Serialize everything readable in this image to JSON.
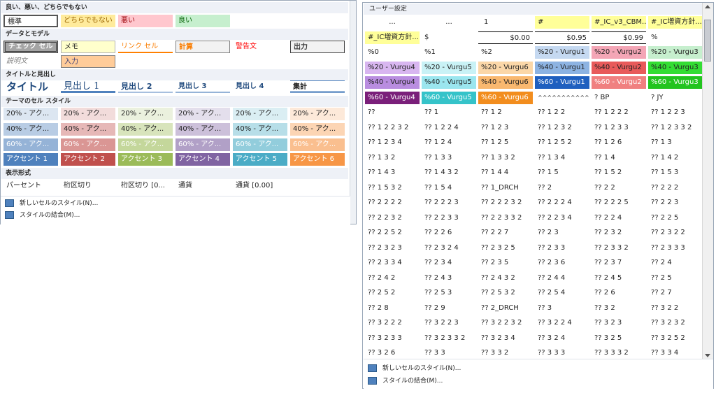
{
  "left": {
    "sections": {
      "good_bad": "良い、悪い、どちらでもない",
      "data_model": "データとモデル",
      "title_heading": "タイトルと見出し",
      "theme": "テーマのセル スタイル",
      "number_format": "表示形式"
    },
    "good_bad_cells": [
      "標準",
      "どちらでもない",
      "悪い",
      "良い"
    ],
    "data_model_row1": [
      "チェック セル",
      "メモ",
      "リンク セル",
      "計算",
      "警告文",
      "出力"
    ],
    "data_model_row2": [
      "説明文",
      "入力"
    ],
    "title_cells": [
      "タイトル",
      "見出し 1",
      "見出し 2",
      "見出し 3",
      "見出し 4",
      "集計"
    ],
    "theme_rows": [
      [
        "20% - アク...",
        "20% - アク...",
        "20% - アク...",
        "20% - アク...",
        "20% - アク...",
        "20% - アク..."
      ],
      [
        "40% - アク...",
        "40% - アク...",
        "40% - アク...",
        "40% - アク...",
        "40% - アク...",
        "40% - アク..."
      ],
      [
        "60% - アク...",
        "60% - アク...",
        "60% - アク...",
        "60% - アク...",
        "60% - アク...",
        "60% - アク..."
      ],
      [
        "アクセント 1",
        "アクセント 2",
        "アクセント 3",
        "アクセント 4",
        "アクセント 5",
        "アクセント 6"
      ]
    ],
    "number_cells": [
      "パーセント",
      "桁区切り",
      "桁区切り [0...",
      "通貨",
      "通貨 [0.00]"
    ],
    "links": [
      "新しいセルのスタイル(N)...",
      "スタイルの結合(M)..."
    ]
  },
  "right": {
    "title": "ユーザー設定",
    "rows": [
      [
        "...",
        "...",
        "1",
        "#",
        "#_IC_v3_CBM...",
        "#_IC増資方針..."
      ],
      [
        "#_IC増資方針...",
        "$",
        "$0.00",
        "$0.95",
        "$0.99",
        "%"
      ],
      [
        "%0",
        "%1",
        "%2",
        "%20 - Vurgu1",
        "%20 - Vurgu2",
        "%20 - Vurgu3"
      ],
      [
        "%20 - Vurgu4",
        "%20 - Vurgu5",
        "%20 - Vurgu6",
        "%40 - Vurgu1",
        "%40 - Vurgu2",
        "%40 - Vurgu3"
      ],
      [
        "%40 - Vurgu4",
        "%40 - Vurgu5",
        "%40 - Vurgu6",
        "%60 - Vurgu1",
        "%60 - Vurgu2",
        "%60 - Vurgu3"
      ],
      [
        "%60 - Vurgu4",
        "%60 - Vurgu5",
        "%60 - Vurgu6",
        "^^^^^^^^^^^^^^^^^",
        "? BP",
        "? JY"
      ],
      [
        "??",
        "?? 1",
        "?? 1 2",
        "?? 1 2 2",
        "?? 1 2 2 2",
        "?? 1 2 2 3"
      ],
      [
        "?? 1 2 2 3 2",
        "?? 1 2 2 4",
        "?? 1 2 3",
        "?? 1 2 3 2",
        "?? 1 2 3 3",
        "?? 1 2 3 3 2"
      ],
      [
        "?? 1 2 3 4",
        "?? 1 2 4",
        "?? 1 2 5",
        "?? 1 2 5 2",
        "?? 1 2 6",
        "?? 1 3"
      ],
      [
        "?? 1 3 2",
        "?? 1 3 3",
        "?? 1 3 3 2",
        "?? 1 3 4",
        "?? 1 4",
        "?? 1 4 2"
      ],
      [
        "?? 1 4 3",
        "?? 1 4 3 2",
        "?? 1 4 4",
        "?? 1 5",
        "?? 1 5 2",
        "?? 1 5 3"
      ],
      [
        "?? 1 5 3 2",
        "?? 1 5 4",
        "?? 1_DRCH",
        "?? 2",
        "?? 2 2",
        "?? 2 2 2"
      ],
      [
        "?? 2 2 2 2",
        "?? 2 2 2 3",
        "?? 2 2 2 3 2",
        "?? 2 2 2 4",
        "?? 2 2 2 5",
        "?? 2 2 3"
      ],
      [
        "?? 2 2 3 2",
        "?? 2 2 3 3",
        "?? 2 2 3 3 2",
        "?? 2 2 3 4",
        "?? 2 2 4",
        "?? 2 2 5"
      ],
      [
        "?? 2 2 5 2",
        "?? 2 2 6",
        "?? 2 2 7",
        "?? 2 3",
        "?? 2 3 2",
        "?? 2 3 2 2"
      ],
      [
        "?? 2 3 2 3",
        "?? 2 3 2 4",
        "?? 2 3 2 5",
        "?? 2 3 3",
        "?? 2 3 3 2",
        "?? 2 3 3 3"
      ],
      [
        "?? 2 3 3 4",
        "?? 2 3 4",
        "?? 2 3 5",
        "?? 2 3 6",
        "?? 2 3 7",
        "?? 2 4"
      ],
      [
        "?? 2 4 2",
        "?? 2 4 3",
        "?? 2 4 3 2",
        "?? 2 4 4",
        "?? 2 4 5",
        "?? 2 5"
      ],
      [
        "?? 2 5 2",
        "?? 2 5 3",
        "?? 2 5 3 2",
        "?? 2 5 4",
        "?? 2 6",
        "?? 2 7"
      ],
      [
        "?? 2 8",
        "?? 2 9",
        "?? 2_DRCH",
        "?? 3",
        "?? 3 2",
        "?? 3 2 2"
      ],
      [
        "?? 3 2 2 2",
        "?? 3 2 2 3",
        "?? 3 2 2 3 2",
        "?? 3 2 2 4",
        "?? 3 2 3",
        "?? 3 2 3 2"
      ],
      [
        "?? 3 2 3 3",
        "?? 3 2 3 3 2",
        "?? 3 2 3 4",
        "?? 3 2 4",
        "?? 3 2 5",
        "?? 3 2 5 2"
      ],
      [
        "?? 3 2 6",
        "?? 3 3",
        "?? 3 3 2",
        "?? 3 3 3",
        "?? 3 3 3 2",
        "?? 3 3 4"
      ]
    ],
    "links": [
      "新しいセルのスタイル(N)...",
      "スタイルの結合(M)..."
    ]
  },
  "colors": {
    "accent1": "#4f81bd",
    "accent2": "#c0504d",
    "accent3": "#9bbb59",
    "accent4": "#8064a2",
    "accent5": "#4bacc6",
    "accent6": "#f79646"
  }
}
